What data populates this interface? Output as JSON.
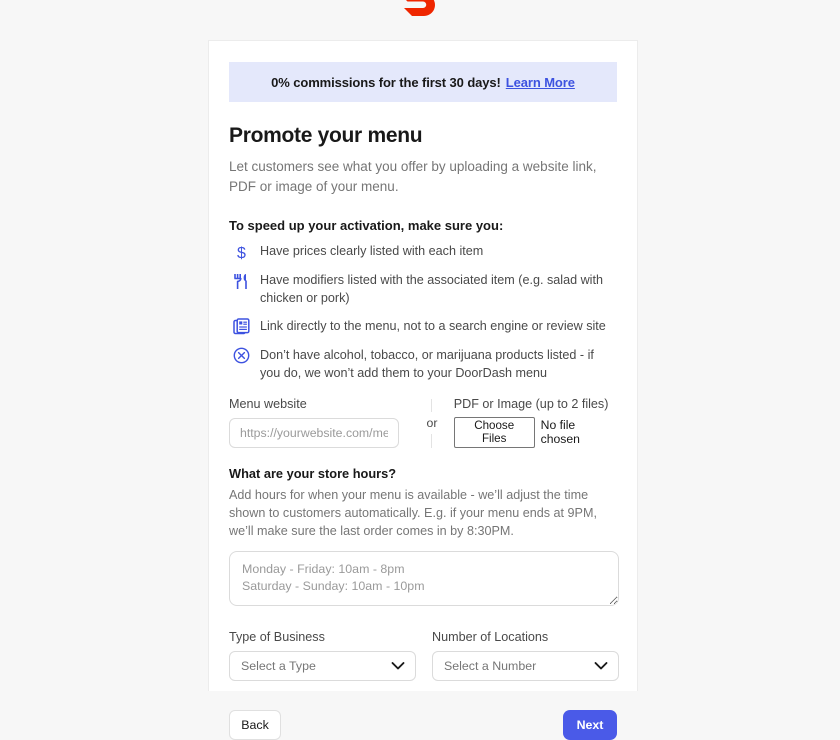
{
  "brand": {
    "logo_name": "doordash-logo",
    "logo_color": "#ef2600"
  },
  "banner": {
    "text": "0% commissions for the first 30 days!",
    "link_label": "Learn More",
    "background": "#e4e8fb",
    "link_color": "#3d52e0"
  },
  "page": {
    "title": "Promote your menu",
    "subtitle": "Let customers see what you offer by uploading a website link, PDF or image of your menu."
  },
  "checklist": {
    "heading": "To speed up your activation, make sure you:",
    "items": [
      {
        "icon": "dollar-sign-icon",
        "text": "Have prices clearly listed with each item"
      },
      {
        "icon": "fork-knife-icon",
        "text": "Have modifiers listed with the associated item (e.g. salad with chicken or pork)"
      },
      {
        "icon": "menu-document-icon",
        "text": "Link directly to the menu, not to a search engine or review site"
      },
      {
        "icon": "circle-x-icon",
        "text": "Don’t have alcohol, tobacco, or marijuana products listed - if you do, we won’t add them to your DoorDash menu"
      }
    ]
  },
  "menu_source": {
    "website_label": "Menu website",
    "website_value": "",
    "website_placeholder": "https://yourwebsite.com/mer",
    "divider_word": "or",
    "file_label": "PDF or Image (up to 2 files)",
    "choose_files_label": "Choose Files",
    "file_status": "No file chosen"
  },
  "store_hours": {
    "heading": "What are your store hours?",
    "description": "Add hours for when your menu is available - we’ll adjust the time shown to customers automatically. E.g. if your menu ends at 9PM, we’ll make sure the last order comes in by 8:30PM.",
    "value": "",
    "placeholder": "Monday - Friday: 10am - 8pm\nSaturday - Sunday: 10am - 10pm"
  },
  "selects": {
    "business_type": {
      "label": "Type of Business",
      "value": "Select a Type"
    },
    "locations": {
      "label": "Number of Locations",
      "value": "Select a Number"
    }
  },
  "footer": {
    "back_label": "Back",
    "next_label": "Next",
    "next_color": "#4a5ae8"
  }
}
